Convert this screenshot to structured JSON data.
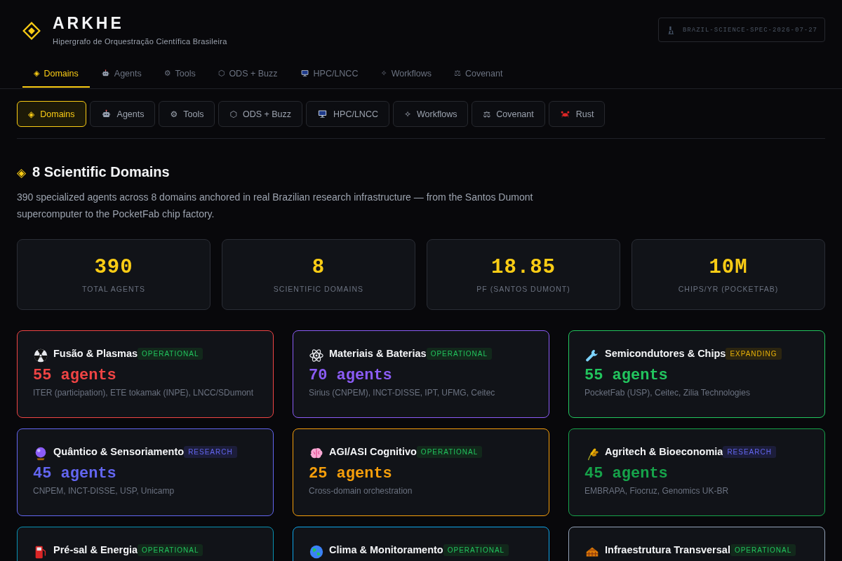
{
  "header": {
    "title": "ARKHE",
    "subtitle": "Hipergrafo de Orquestração Científica Brasileira",
    "spec": "BRAZIL-SCIENCE-SPEC-2026-07-27"
  },
  "nav_tabs": [
    {
      "glyph": "◈",
      "label": "Domains",
      "selected": true
    },
    {
      "label": "Agents",
      "selected": false
    },
    {
      "glyph": "⚙",
      "label": "Tools",
      "selected": false
    },
    {
      "glyph": "⬡",
      "label": "ODS + Buzz",
      "selected": false
    },
    {
      "label": "HPC/LNCC",
      "selected": false
    },
    {
      "glyph": "✧",
      "label": "Workflows",
      "selected": false
    },
    {
      "glyph": "⚖",
      "label": "Covenant",
      "selected": false
    }
  ],
  "pill_tabs": [
    {
      "glyph": "◈",
      "label": "Domains",
      "selected": true
    },
    {
      "label": "Agents",
      "selected": false
    },
    {
      "glyph": "⚙",
      "label": "Tools",
      "selected": false
    },
    {
      "glyph": "⬡",
      "label": "ODS + Buzz",
      "selected": false
    },
    {
      "label": "HPC/LNCC",
      "selected": false
    },
    {
      "glyph": "✧",
      "label": "Workflows",
      "selected": false
    },
    {
      "glyph": "⚖",
      "label": "Covenant",
      "selected": false
    },
    {
      "label": "Rust",
      "selected": false
    }
  ],
  "section": {
    "glyph": "◈",
    "title": "8 Scientific Domains",
    "description": "390 specialized agents across 8 domains anchored in real Brazilian research infrastructure — from the Santos Dumont supercomputer to the PocketFab chip factory."
  },
  "stats": [
    {
      "value": "390",
      "label": "TOTAL AGENTS"
    },
    {
      "value": "8",
      "label": "SCIENTIFIC DOMAINS"
    },
    {
      "value": "18.85",
      "label": "PF (SANTOS DUMONT)"
    },
    {
      "value": "10M",
      "label": "CHIPS/YR (POCKETFAB)"
    }
  ],
  "domains": [
    {
      "title": "Fusão & Plasmas",
      "badge": {
        "text": "OPERATIONAL",
        "kind": "operational"
      },
      "agents": "55 agents",
      "institutions": "ITER (participation), ETE tokamak (INPE), LNCC/SDumont",
      "color": "#ef4444"
    },
    {
      "title": "Materiais & Baterias",
      "badge": {
        "text": "OPERATIONAL",
        "kind": "operational"
      },
      "agents": "70 agents",
      "institutions": "Sirius (CNPEM), INCT-DISSE, IPT, UFMG, Ceitec",
      "color": "#8b5cf6"
    },
    {
      "title": "Semicondutores & Chips",
      "badge": {
        "text": "EXPANDING",
        "kind": "expanding"
      },
      "agents": "55 agents",
      "institutions": "PocketFab (USP), Ceitec, Zilia Technologies",
      "color": "#22c55e"
    },
    {
      "title": "Quântico & Sensoriamento",
      "badge": {
        "text": "RESEARCH",
        "kind": "research"
      },
      "agents": "45 agents",
      "institutions": "CNPEM, INCT-DISSE, USP, Unicamp",
      "color": "#6366f1"
    },
    {
      "title": "AGI/ASI Cognitivo",
      "badge": {
        "text": "OPERATIONAL",
        "kind": "operational"
      },
      "agents": "25 agents",
      "institutions": "Cross-domain orchestration",
      "color": "#f59e0b"
    },
    {
      "title": "Agritech & Bioeconomia",
      "badge": {
        "text": "RESEARCH",
        "kind": "research"
      },
      "agents": "45 agents",
      "institutions": "EMBRAPA, Fiocruz, Genomics UK-BR",
      "color": "#16a34a"
    },
    {
      "title": "Pré-sal & Energia",
      "badge": {
        "text": "OPERATIONAL",
        "kind": "operational"
      },
      "color": "#0891b2"
    },
    {
      "title": "Clima & Monitoramento",
      "badge": {
        "text": "OPERATIONAL",
        "kind": "operational"
      },
      "color": "#0ea5e9"
    },
    {
      "title": "Infraestrutura Transversal",
      "badge": {
        "text": "OPERATIONAL",
        "kind": "operational"
      },
      "color": "#94a3b8"
    }
  ]
}
